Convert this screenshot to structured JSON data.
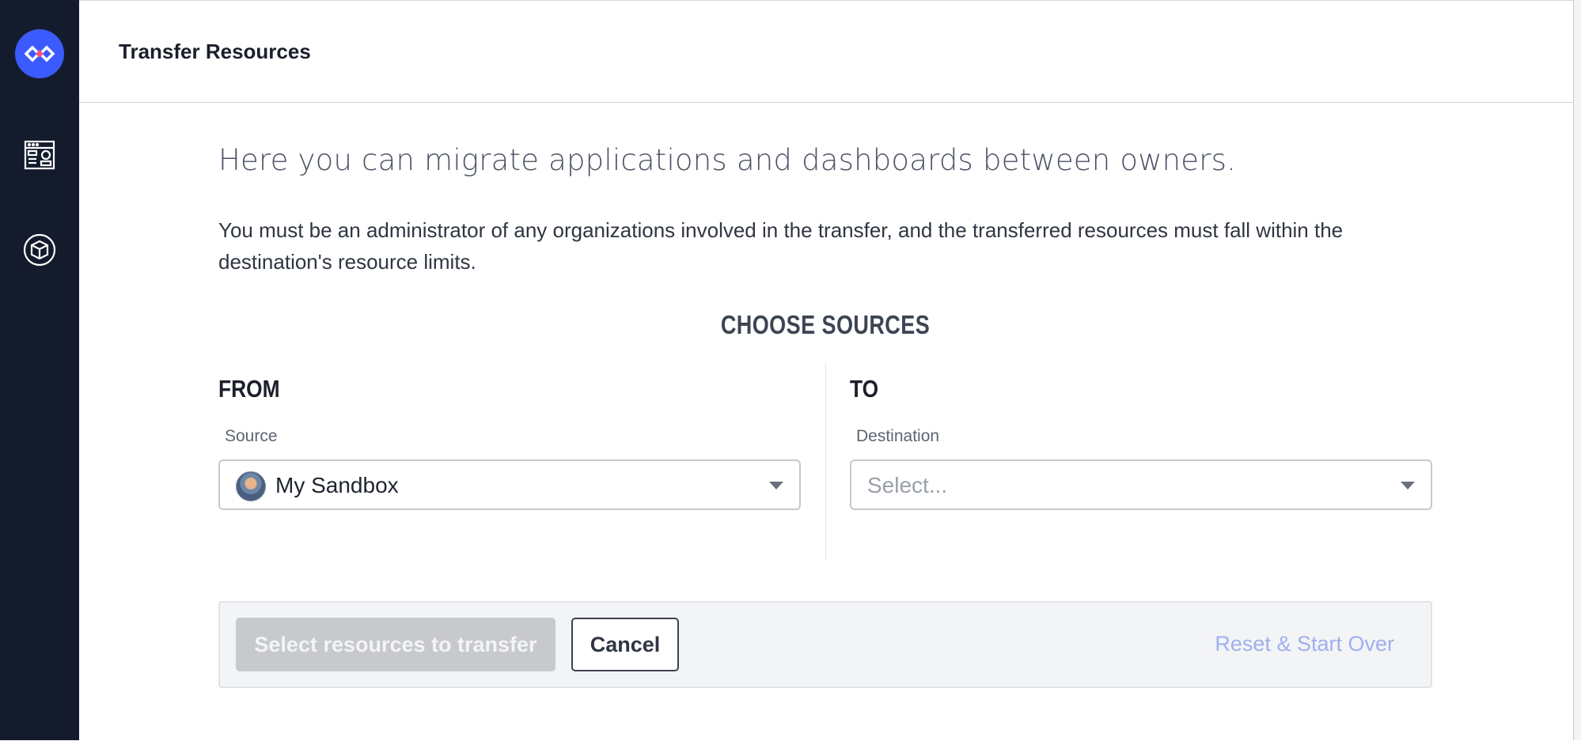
{
  "sidebar": {
    "logo_icon": "app-logo-icon",
    "items": [
      {
        "icon": "dashboard-layout-icon"
      },
      {
        "icon": "cube-icon"
      }
    ]
  },
  "header": {
    "title": "Transfer Resources"
  },
  "intro": "Here you can migrate applications and dashboards between owners.",
  "description": "You must be an administrator of any organizations involved in the transfer, and the transferred resources must fall within the destination's resource limits.",
  "choose_title": "CHOOSE SOURCES",
  "from": {
    "title": "FROM",
    "label": "Source",
    "value": "My Sandbox"
  },
  "to": {
    "title": "TO",
    "label": "Destination",
    "placeholder": "Select..."
  },
  "actions": {
    "primary": "Select resources to transfer",
    "cancel": "Cancel",
    "reset": "Reset & Start Over"
  },
  "colors": {
    "sidebar": "#141b2d",
    "logo": "#3b5bff",
    "link": "#9fb0ee"
  }
}
